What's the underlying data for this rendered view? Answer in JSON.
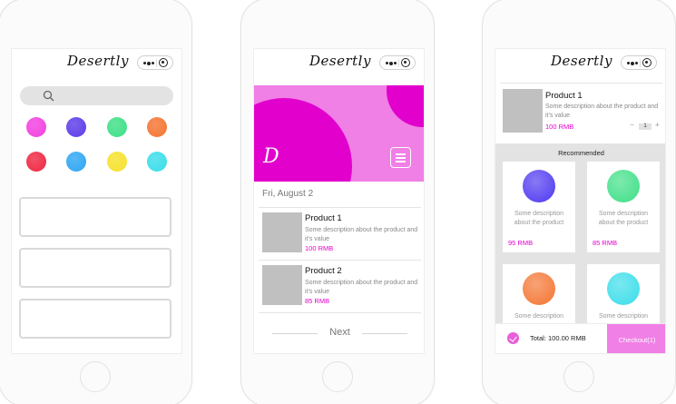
{
  "app": {
    "logo": "Desertly"
  },
  "screen1": {
    "swatch_colors": [
      "#f23fe0",
      "#5b3be8",
      "#3ddf86",
      "#f47431",
      "#ee2742",
      "#2ea6f2",
      "#f6e12a",
      "#38dde9"
    ]
  },
  "screen2": {
    "date": "Fri, August 2",
    "products": [
      {
        "name": "Product 1",
        "description": "Some description about the product and it's value",
        "price": "100 RMB"
      },
      {
        "name": "Product 2",
        "description": "Some description about the product and it's value",
        "price": "85 RMB"
      }
    ],
    "next_label": "Next"
  },
  "screen3": {
    "cart_item": {
      "name": "Product 1",
      "description": "Some description about the product and it's value",
      "price": "100 RMB",
      "quantity": "1"
    },
    "recommended_title": "Recommended",
    "recommended": [
      {
        "description": "Some description about the product",
        "price": "95 RMB",
        "color": "#4d37f0"
      },
      {
        "description": "Some description about the product",
        "price": "85 RMB",
        "color": "#3ddf86"
      },
      {
        "description": "Some description",
        "price": "",
        "color": "#f47431"
      },
      {
        "description": "Some description",
        "price": "",
        "color": "#38dde9"
      }
    ],
    "total": "Total: 100.00 RMB",
    "checkout_label": "Checkout(1)"
  },
  "colors": {
    "accent": "#e200cc",
    "accent_light": "#f07fe6"
  }
}
